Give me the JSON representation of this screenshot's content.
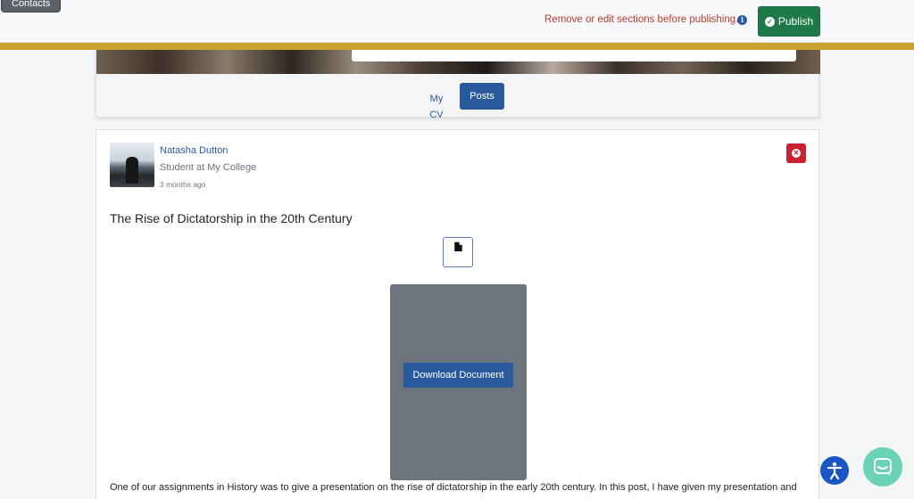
{
  "topbar": {
    "contacts_tab": "Contacts",
    "warning_text": "Remove or edit sections before publishing.",
    "info_icon": "info-icon",
    "publish_label": "Publish"
  },
  "profile_tabs": {
    "my_cv": "My CV",
    "posts": "Posts",
    "active": "Posts"
  },
  "post": {
    "author_name": "Natasha Dutton",
    "author_role": "Student at My College",
    "time_ago": "3 months ago",
    "title": "The Rise of Dictatorship in the 20th Century",
    "download_label": "Download Document",
    "body": "One of our assignments in History was to give a presentation on the rise of dictatorship in the early 20th century. In this post, I have given my presentation and"
  },
  "colors": {
    "accent_blue": "#2a5a9e",
    "publish_green": "#1f7a4a",
    "warning_red": "#c0392b",
    "delete_red": "#c82333",
    "gold_divider": "#c9a132",
    "document_preview_gray": "#6c757d",
    "chat_teal": "#6ad3b5"
  },
  "icons": {
    "publish": "check-circle-icon",
    "delete": "close-circle-icon",
    "document": "file-icon",
    "accessibility": "accessibility-icon",
    "chat": "chat-icon"
  }
}
